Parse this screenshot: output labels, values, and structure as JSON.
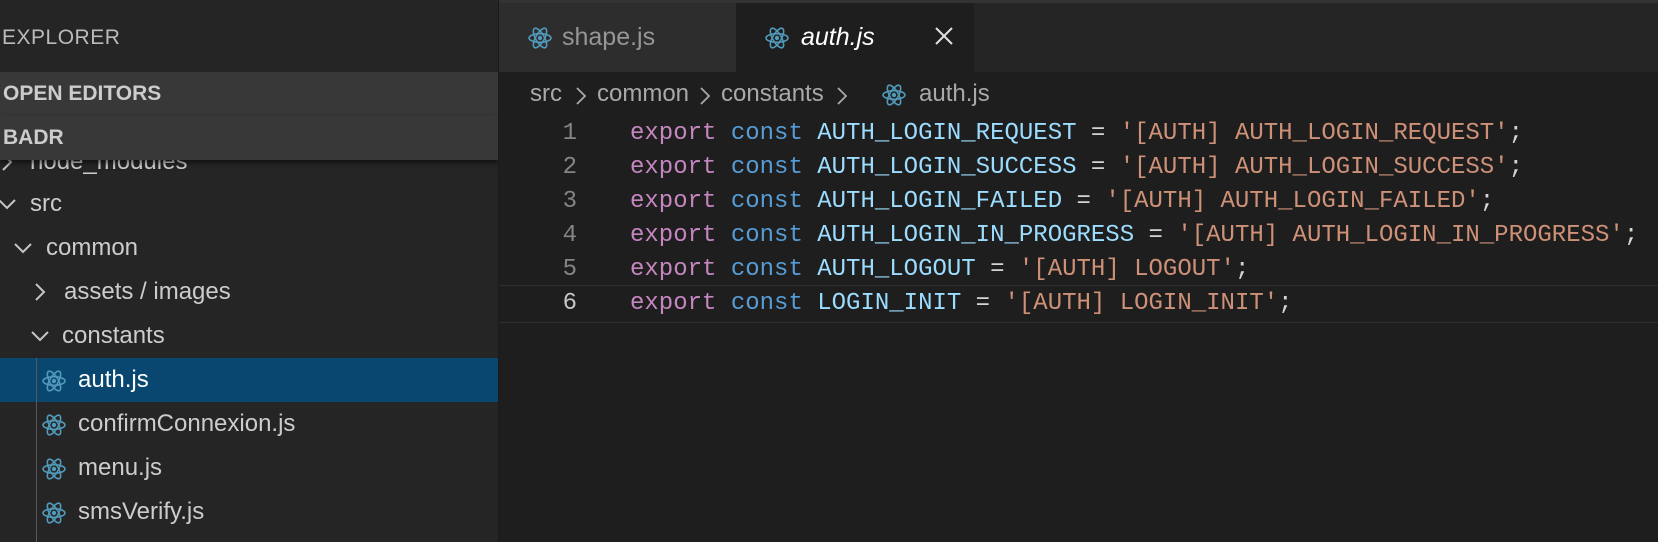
{
  "sidebar": {
    "title": "EXPLORER",
    "sections": {
      "open_editors": "OPEN EDITORS",
      "project": "BADR"
    },
    "tree": {
      "node_modules": "node_modules",
      "src": "src",
      "common": "common",
      "assets": "assets / images",
      "constants": "constants",
      "files": [
        "auth.js",
        "confirmConnexion.js",
        "menu.js",
        "smsVerify.js"
      ]
    }
  },
  "tabs": [
    {
      "label": "shape.js",
      "active": false
    },
    {
      "label": "auth.js",
      "active": true
    }
  ],
  "breadcrumb": [
    "src",
    "common",
    "constants",
    "auth.js"
  ],
  "editor": {
    "lines": [
      {
        "num": "1",
        "kw": "export",
        "st": "const",
        "id": "AUTH_LOGIN_REQUEST",
        "eq": " = ",
        "str": "'[AUTH] AUTH_LOGIN_REQUEST'",
        "end": ";"
      },
      {
        "num": "2",
        "kw": "export",
        "st": "const",
        "id": "AUTH_LOGIN_SUCCESS",
        "eq": " = ",
        "str": "'[AUTH] AUTH_LOGIN_SUCCESS'",
        "end": ";"
      },
      {
        "num": "3",
        "kw": "export",
        "st": "const",
        "id": "AUTH_LOGIN_FAILED",
        "eq": " = ",
        "str": "'[AUTH] AUTH_LOGIN_FAILED'",
        "end": ";"
      },
      {
        "num": "4",
        "kw": "export",
        "st": "const",
        "id": "AUTH_LOGIN_IN_PROGRESS",
        "eq": " = ",
        "str": "'[AUTH] AUTH_LOGIN_IN_PROGRESS'",
        "end": ";"
      },
      {
        "num": "5",
        "kw": "export",
        "st": "const",
        "id": "AUTH_LOGOUT",
        "eq": " = ",
        "str": "'[AUTH] LOGOUT'",
        "end": ";"
      },
      {
        "num": "6",
        "kw": "export",
        "st": "const",
        "id": "LOGIN_INIT",
        "eq": " = ",
        "str": "'[AUTH] LOGIN_INIT'",
        "end": ";"
      }
    ]
  },
  "colors": {
    "selection": "#094771",
    "react_icon": "#519aba",
    "keyword": "#c586c0",
    "storage": "#569cd6",
    "identifier": "#9cdcfe",
    "string": "#ce9178"
  }
}
